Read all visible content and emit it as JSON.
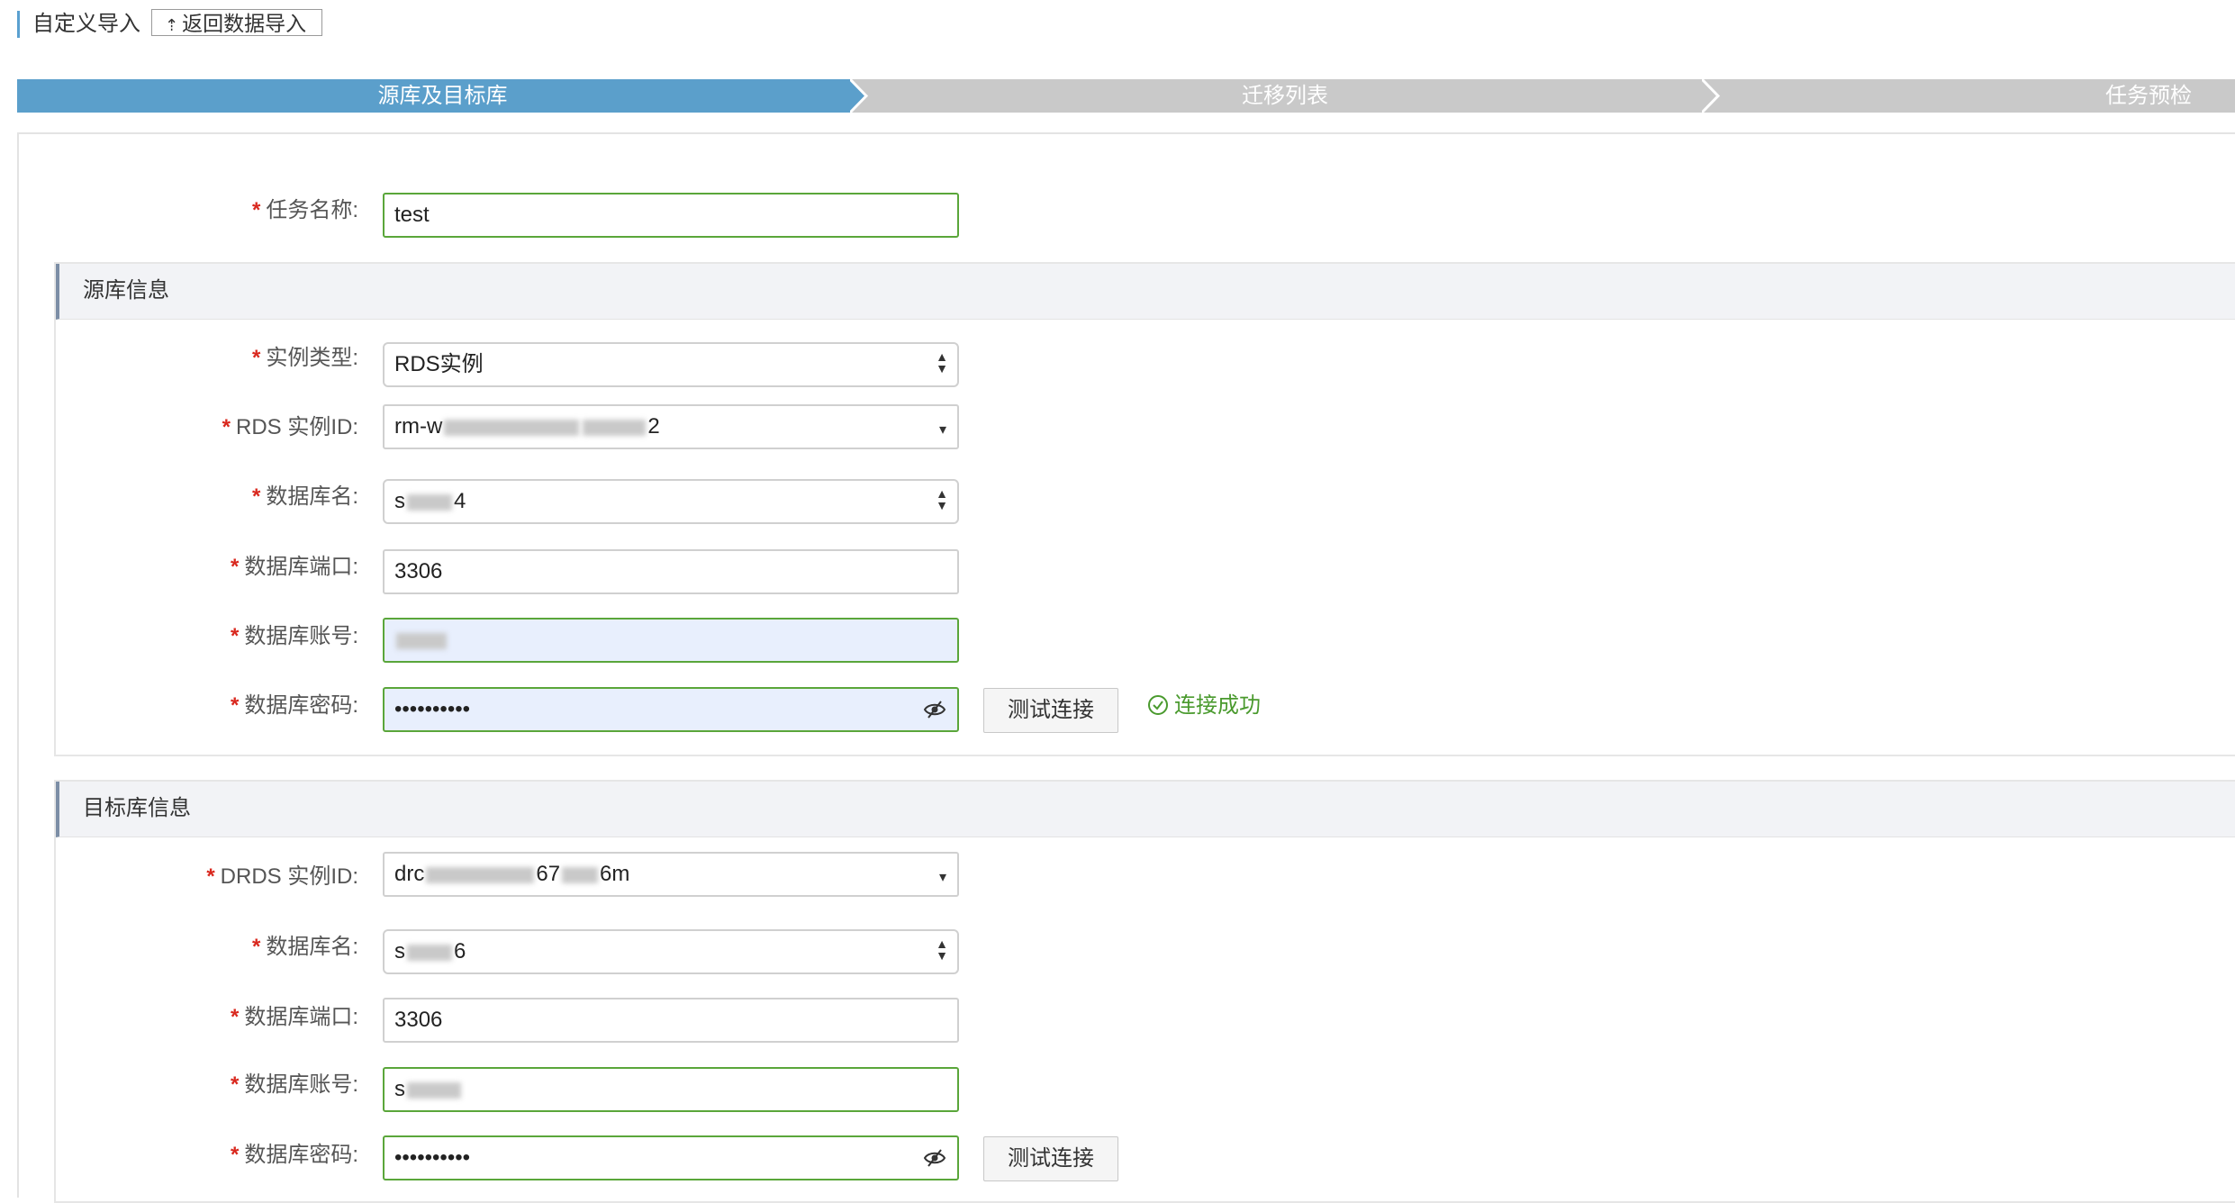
{
  "header": {
    "title": "自定义导入",
    "back_button": "返回数据导入",
    "back_icon": "upload-arrow-icon"
  },
  "steps": [
    {
      "label": "源库及目标库",
      "active": true
    },
    {
      "label": "迁移列表",
      "active": false
    },
    {
      "label": "任务预检",
      "active": false
    }
  ],
  "colors": {
    "step_active": "#5b9fcb",
    "step_inactive": "#c9c9c9",
    "success": "#4a9a2e",
    "required": "#d9281e",
    "valid_border": "#5aa63a"
  },
  "task": {
    "label": "任务名称:",
    "value": "test"
  },
  "source": {
    "title": "源库信息",
    "instance_type": {
      "label": "实例类型:",
      "value": "RDS实例"
    },
    "rds_id": {
      "label": "RDS 实例ID:",
      "prefix": "rm-w",
      "suffix": "2"
    },
    "db_name": {
      "label": "数据库名:",
      "prefix": "s",
      "suffix": "4"
    },
    "port": {
      "label": "数据库端口:",
      "value": "3306"
    },
    "account": {
      "label": "数据库账号:"
    },
    "password": {
      "label": "数据库密码:",
      "value": "••••••••••"
    },
    "test_button": "测试连接",
    "status": "连接成功"
  },
  "target": {
    "title": "目标库信息",
    "drds_id": {
      "label": "DRDS 实例ID:",
      "prefix": "drc",
      "mid": "67",
      "suffix": "6m"
    },
    "db_name": {
      "label": "数据库名:",
      "prefix": "s",
      "suffix": "6"
    },
    "port": {
      "label": "数据库端口:",
      "value": "3306"
    },
    "account": {
      "label": "数据库账号:",
      "prefix": "s"
    },
    "password": {
      "label": "数据库密码:",
      "value": "••••••••••"
    },
    "test_button": "测试连接"
  }
}
